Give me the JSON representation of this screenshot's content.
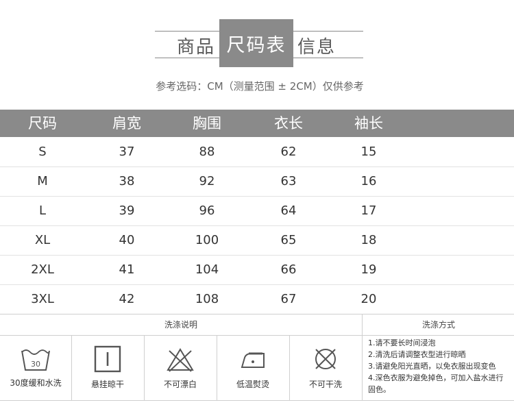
{
  "header": {
    "title_left": "商品",
    "title_box": "尺码表",
    "title_right": "信息",
    "subtitle": "参考选码：CM（测量范围 ± 2CM）仅供参考"
  },
  "size_table": {
    "columns": [
      "尺码",
      "肩宽",
      "胸围",
      "衣长",
      "袖长"
    ],
    "rows": [
      [
        "S",
        "37",
        "88",
        "62",
        "15"
      ],
      [
        "M",
        "38",
        "92",
        "63",
        "16"
      ],
      [
        "L",
        "39",
        "96",
        "64",
        "17"
      ],
      [
        "XL",
        "40",
        "100",
        "65",
        "18"
      ],
      [
        "2XL",
        "41",
        "104",
        "66",
        "19"
      ],
      [
        "3XL",
        "42",
        "108",
        "67",
        "20"
      ]
    ]
  },
  "care": {
    "left_title": "洗涤说明",
    "right_title": "洗涤方式",
    "icons": [
      {
        "icon": "wash-30-icon",
        "label": "30度缓和水洗",
        "number": "30"
      },
      {
        "icon": "hang-dry-icon",
        "label": "悬挂晾干"
      },
      {
        "icon": "no-bleach-icon",
        "label": "不可漂白"
      },
      {
        "icon": "low-iron-icon",
        "label": "低温熨烫"
      },
      {
        "icon": "no-dry-clean-icon",
        "label": "不可干洗"
      }
    ],
    "notes": [
      "1.请不要长时间浸泡",
      "2.清洗后请调整衣型进行晾晒",
      "3.请避免阳光直晒，以免衣服出现变色",
      "4.深色衣服为避免掉色，可加入盐水进行固色。"
    ]
  },
  "colors": {
    "header_gray": "#8a8a8a",
    "text": "#333333"
  }
}
